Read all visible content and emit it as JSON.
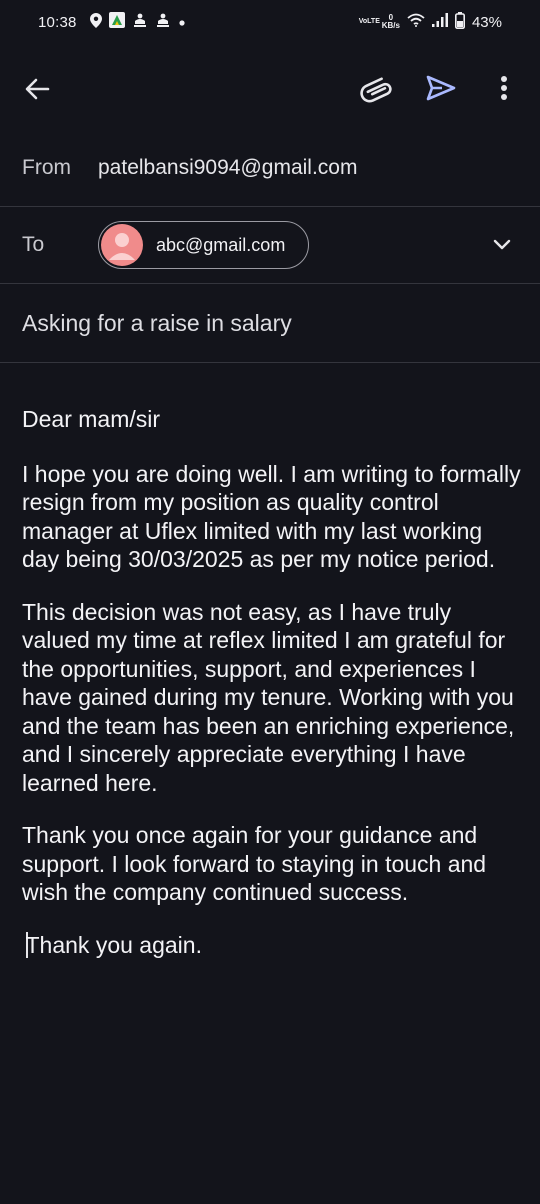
{
  "status_bar": {
    "time": "10:38",
    "network_label": "VoLTE",
    "speed_value": "0",
    "speed_unit": "KB/s",
    "battery": "43%"
  },
  "toolbar": {
    "back_icon": "arrow-left-icon",
    "attach_icon": "paperclip-icon",
    "send_icon": "send-icon",
    "more_icon": "more-vert-icon",
    "send_color": "#aab9ff"
  },
  "from": {
    "label": "From",
    "value": "patelbansi9094@gmail.com"
  },
  "to": {
    "label": "To",
    "recipient": "abc@gmail.com",
    "avatar_color": "#f08b8b",
    "expand_icon": "chevron-down-icon"
  },
  "subject": {
    "value": "Asking for a raise in salary"
  },
  "body": {
    "greeting": "Dear mam/sir",
    "paragraph1": "I hope you are doing well. I am writing to formally resign from my position as quality control manager at Uflex limited with my last working day being  30/03/2025 as per my notice period.",
    "paragraph2": "This decision was not easy, as I have truly valued my time at reflex limited I am grateful for the opportunities, support, and experiences I have gained during my tenure. Working with you and the team has been an enriching experience, and I sincerely appreciate everything I have learned here.",
    "paragraph3": "Thank you once again for your guidance and support. I look forward to staying in touch and wish the company continued success.",
    "closing": "Thank you again."
  }
}
